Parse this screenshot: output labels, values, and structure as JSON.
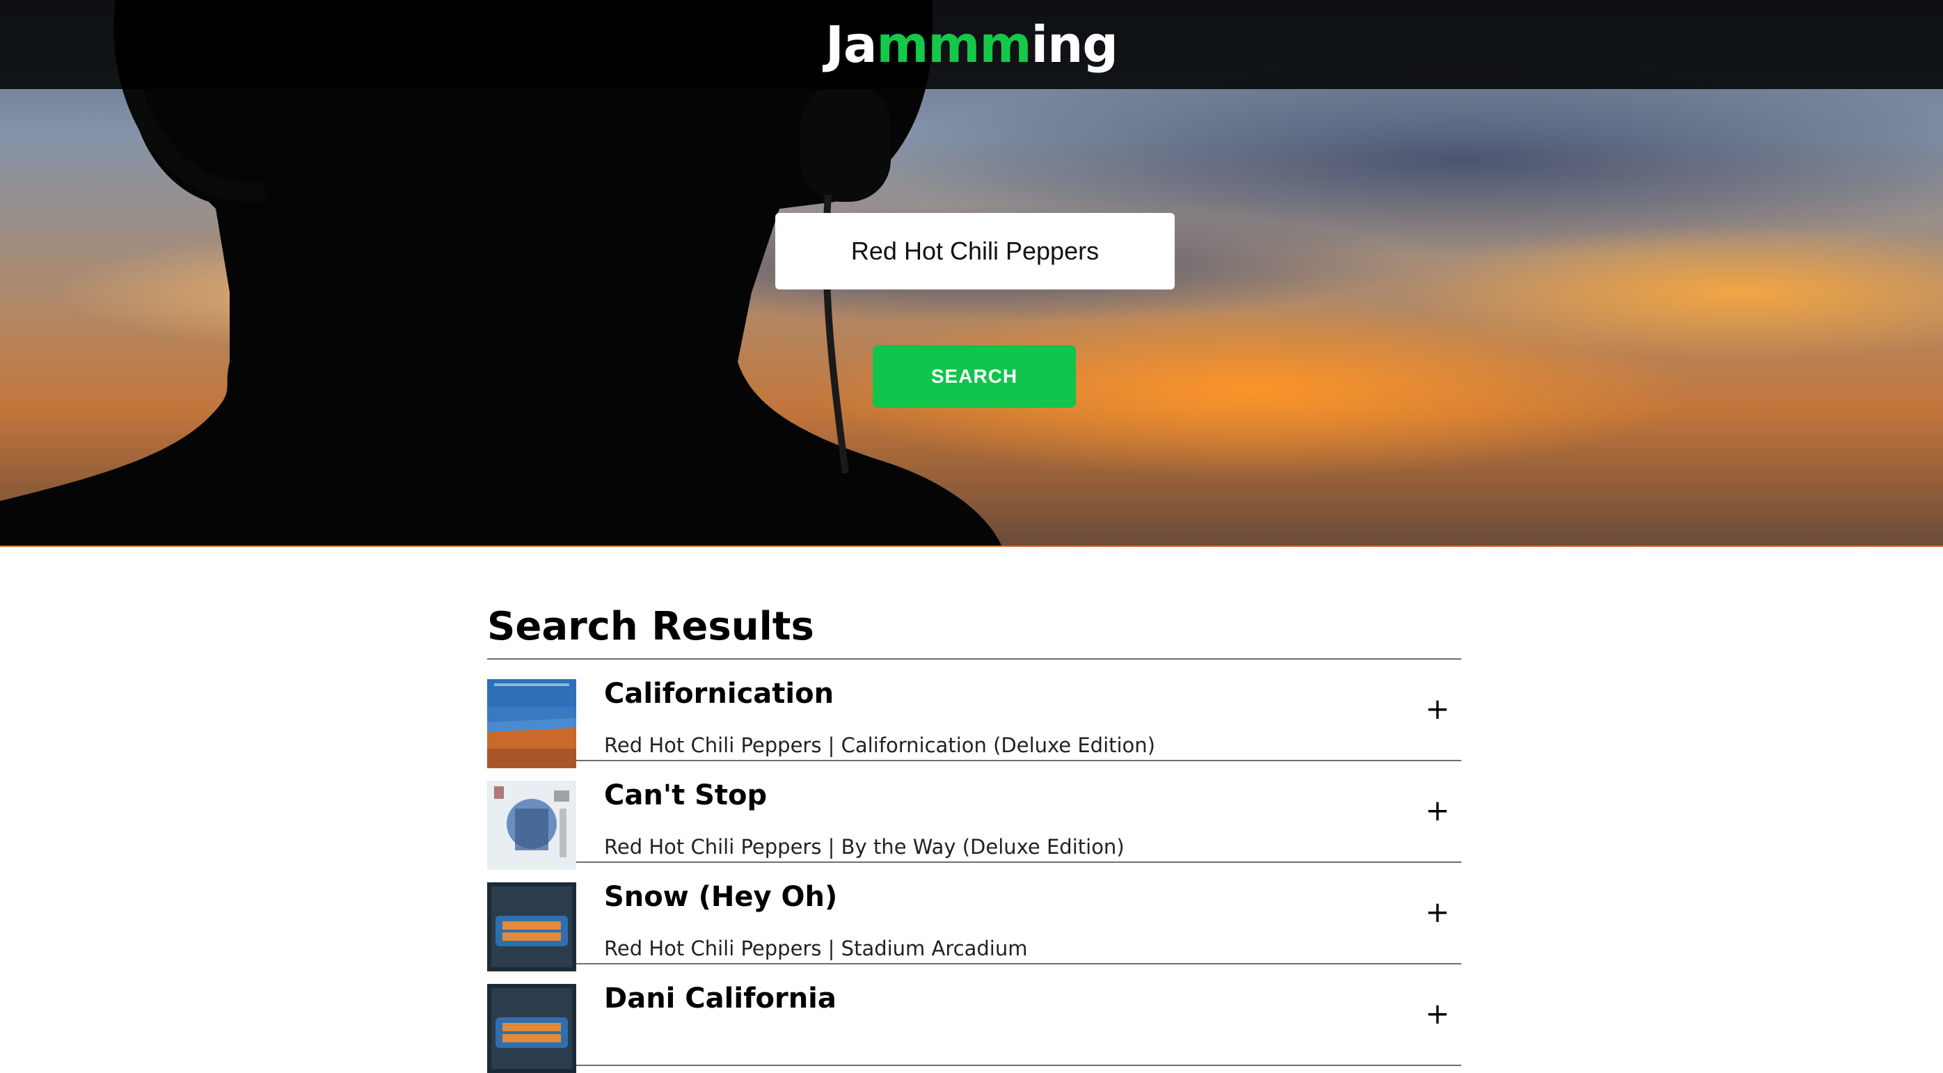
{
  "app": {
    "logo_parts": [
      "Ja",
      "mmm",
      "ing"
    ]
  },
  "search": {
    "value": "Red Hot Chili Peppers",
    "button_label": "SEARCH"
  },
  "results": {
    "title": "Search Results",
    "tracks": [
      {
        "name": "Californication",
        "info": "Red Hot Chili Peppers | Californication (Deluxe Edition)",
        "add_label": "+",
        "art": "californication-cover"
      },
      {
        "name": "Can't Stop",
        "info": "Red Hot Chili Peppers | By the Way (Deluxe Edition)",
        "add_label": "+",
        "art": "by-the-way-cover"
      },
      {
        "name": "Snow (Hey Oh)",
        "info": "Red Hot Chili Peppers | Stadium Arcadium",
        "add_label": "+",
        "art": "stadium-arcadium-cover"
      },
      {
        "name": "Dani California",
        "info": "",
        "add_label": "+",
        "art": "stadium-arcadium-cover"
      }
    ]
  },
  "colors": {
    "accent": "#16c84a",
    "button": "#10c44c",
    "header_bg": "#1e1e1e",
    "divider": "#6e6e6e"
  },
  "icons": [
    "plus-icon"
  ]
}
